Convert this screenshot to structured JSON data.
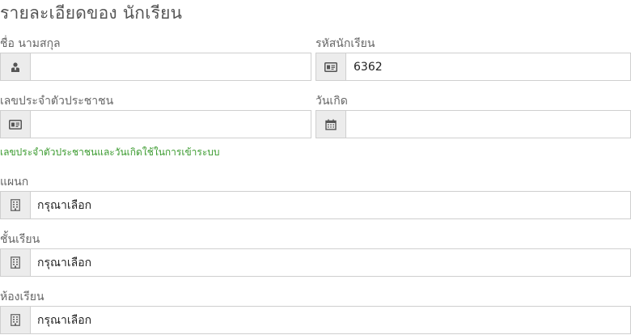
{
  "page": {
    "title": "รายละเอียดของ นักเรียน"
  },
  "form": {
    "fullname": {
      "label": "ชื่อ นามสกุล",
      "value": "",
      "icon": "user-icon"
    },
    "student_id": {
      "label": "รหัสนักเรียน",
      "value": "6362",
      "icon": "id-card-icon"
    },
    "citizen_id": {
      "label": "เลขประจำตัวประชาชน",
      "value": "",
      "icon": "id-card-icon"
    },
    "birthdate": {
      "label": "วันเกิด",
      "value": "",
      "icon": "calendar-icon"
    },
    "login_hint": "เลขประจำตัวประชาชนและวันเกิดใช้ในการเข้าระบบ",
    "department": {
      "label": "แผนก",
      "selected": "กรุณาเลือก",
      "icon": "building-icon"
    },
    "grade": {
      "label": "ชั้นเรียน",
      "selected": "กรุณาเลือก",
      "icon": "building-icon"
    },
    "classroom": {
      "label": "ห้องเรียน",
      "selected": "กรุณาเลือก",
      "icon": "building-icon"
    }
  },
  "colors": {
    "hint": "#3a9a2e",
    "addon_bg": "#ececec",
    "border": "#cfcfcf"
  }
}
